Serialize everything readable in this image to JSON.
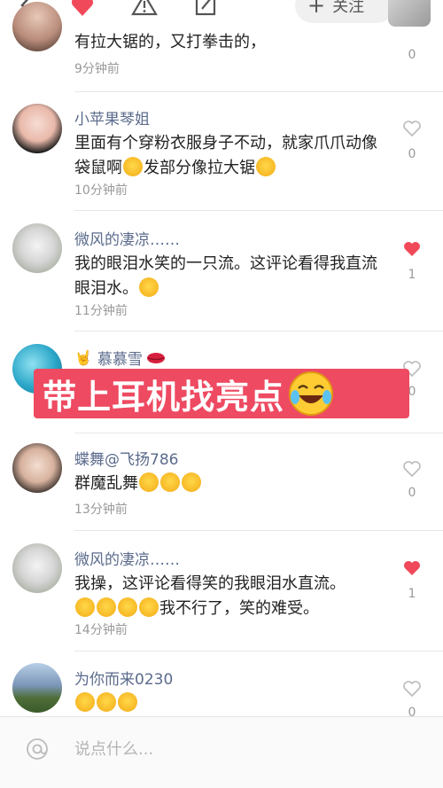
{
  "topbar": {
    "icons": [
      "back-icon",
      "heart-icon",
      "warning-icon",
      "edit-icon"
    ],
    "follow_label": "关注",
    "follow_plus": "+"
  },
  "comments": [
    {
      "name": "",
      "text": "有拉大锯的，又打拳击的，",
      "time": "9分钟前",
      "likes": "0",
      "liked": false
    },
    {
      "name": "小苹果琴姐",
      "text": "里面有个穿粉衣服身子不动，就家爪爪动像袋鼠啊",
      "text_suffix": "发部分像拉大锯",
      "time": "10分钟前",
      "likes": "0",
      "liked": false
    },
    {
      "name": "微风的凄凉……",
      "text": "我的眼泪水笑的一只流。这评论看得我直流眼泪水。",
      "time": "11分钟前",
      "likes": "1",
      "liked": true
    },
    {
      "name": "慕慕雪",
      "text": "",
      "time": "",
      "likes": "0",
      "liked": false
    },
    {
      "name": "蝶舞@飞扬786",
      "text": "群魔乱舞",
      "time": "13分钟前",
      "likes": "0",
      "liked": false
    },
    {
      "name": "微风的凄凉……",
      "text": "我操，这评论看得笑的我眼泪水直流。",
      "text_suffix": "我不行了，笑的难受。",
      "time": "14分钟前",
      "likes": "1",
      "liked": true
    },
    {
      "name": "为你而来0230",
      "text": "",
      "time": "",
      "likes": "0",
      "liked": false
    }
  ],
  "overlay": {
    "text": "带上耳机找亮点"
  },
  "input": {
    "placeholder": "说点什么..."
  },
  "colors": {
    "accent_red": "#ee4a62",
    "name_blue": "#5b6b8c",
    "like_red": "#f04a5a"
  }
}
